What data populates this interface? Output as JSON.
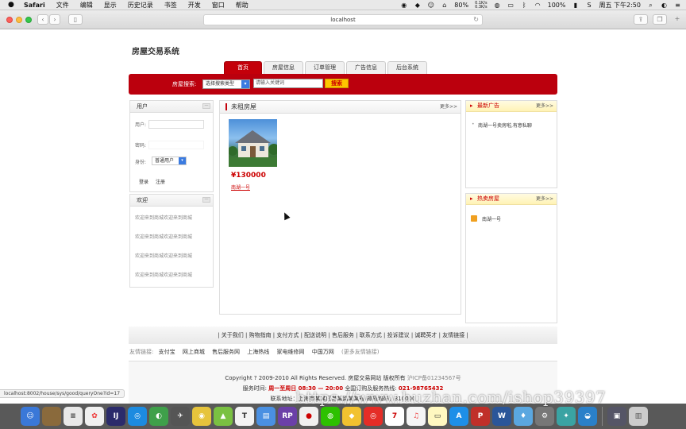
{
  "menubar": {
    "app_name": "Safari",
    "items": [
      "文件",
      "编辑",
      "显示",
      "历史记录",
      "书签",
      "开发",
      "窗口",
      "帮助"
    ],
    "net_up": "0.1K/s",
    "net_down": "0.3K/s",
    "battery_a": "80%",
    "battery_b": "100%",
    "clock": "周五 下午2:50"
  },
  "browser": {
    "url": "localhost",
    "status_url": "localhost:8002/house/sys/good/queryOne?id=17"
  },
  "site": {
    "title": "房屋交易系统",
    "nav": [
      "首页",
      "房屋信息",
      "订单管理",
      "广告信息",
      "后台系统"
    ],
    "search": {
      "label": "房屋搜索:",
      "type_select": "选择搜索类型",
      "keyword_placeholder": "请输入关键词",
      "button": "搜索"
    }
  },
  "login_panel": {
    "title": "用户",
    "username_label": "用户:",
    "password_label": "密码:",
    "role_label": "身份:",
    "role_value": "普通用户",
    "login_btn": "登录",
    "register_btn": "注册"
  },
  "welcome_panel": {
    "title": "欢迎",
    "lines": [
      "欢迎来到商城欢迎来到商城",
      "欢迎来到商城欢迎来到商城",
      "欢迎来到商城欢迎来到商城",
      "欢迎来到商城欢迎来到商城"
    ]
  },
  "main_panel": {
    "title": "未租房屋",
    "more": "更多>>",
    "listing": {
      "price": "¥130000",
      "name": "南湖一号"
    }
  },
  "ads_panel": {
    "title": "最新广告",
    "more": "更多>>",
    "items": [
      "南湖一号卖房啦,有意私聊"
    ]
  },
  "hot_panel": {
    "title": "热卖房屋",
    "more": "更多>>",
    "items": [
      "南湖一号"
    ]
  },
  "footer": {
    "links": "| 关于我们 | 购物指南 | 支付方式 | 配送说明 | 售后服务 | 联系方式 | 投诉建议 | 诚聘英才 | 友情链接 |",
    "friends_label": "友情链接:",
    "friends": [
      "支付宝",
      "网上商城",
      "售后服务网",
      "上海热线",
      "家电维修网",
      "中国万网"
    ],
    "friends_more": "(更多友情链接)",
    "copyright": "Copyright ? 2009-2010 All Rights Reserved. 房屋交易网站 版权所有",
    "icp": "沪ICP备01234567号",
    "service_label": "服务时间:",
    "service_hours": "周一至周日 08:30 — 20:00",
    "hotline_label": "全国订购及服务热线:",
    "hotline": "021-98765432",
    "address": "联系地址：上海市某某区某某路某某号 邮政编码：310000"
  },
  "watermark": "https://www.huzhan.com/ishop39397",
  "colors": {
    "brand_red": "#bb000d",
    "price_red": "#cc0000",
    "button_yellow": "#ffc600"
  }
}
